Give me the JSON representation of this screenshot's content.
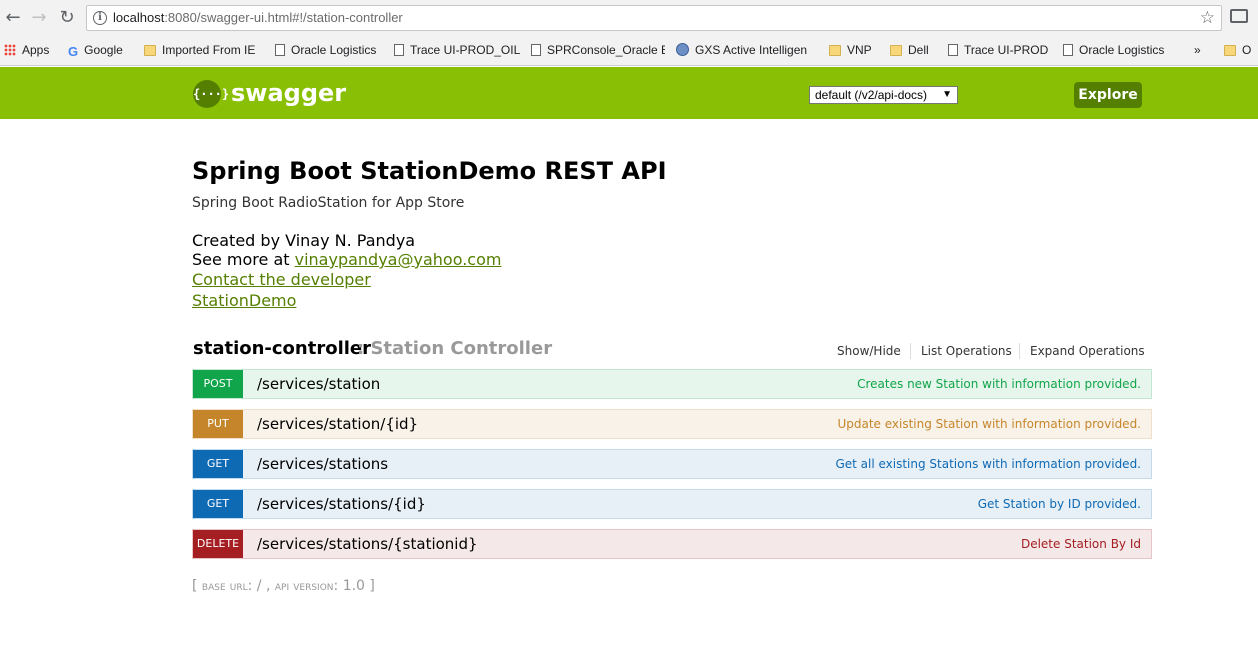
{
  "browser": {
    "url_host": "localhost",
    "url_rest": ":8080/swagger-ui.html#!/station-controller",
    "bookmarks": [
      {
        "label": "Apps",
        "icon": "apps-grid-icon"
      },
      {
        "label": "Google",
        "icon": "google-icon"
      },
      {
        "label": "Imported From IE",
        "icon": "folder-icon"
      },
      {
        "label": "Oracle Logistics",
        "icon": "page-icon"
      },
      {
        "label": "Trace UI-PROD_OIL",
        "icon": "page-icon"
      },
      {
        "label": "SPRConsole_Oracle E",
        "icon": "page-icon"
      },
      {
        "label": "GXS  Active Intelligen",
        "icon": "globe-icon"
      },
      {
        "label": "VNP",
        "icon": "folder-icon"
      },
      {
        "label": "Dell",
        "icon": "folder-icon"
      },
      {
        "label": "Trace UI-PROD",
        "icon": "page-icon"
      },
      {
        "label": "Oracle Logistics",
        "icon": "page-icon"
      },
      {
        "label": "»",
        "icon": ""
      },
      {
        "label": "O",
        "icon": "folder-icon"
      }
    ]
  },
  "header": {
    "logo_symbol": "{···}",
    "logo_text": "swagger",
    "spec_select": "default (/v2/api-docs)",
    "explore_label": "Explore"
  },
  "info": {
    "title": "Spring Boot StationDemo REST API",
    "description": "Spring Boot RadioStation for App Store",
    "created_by": "Created by Vinay N. Pandya",
    "see_more_prefix": "See more at ",
    "email": "vinaypandya@yahoo.com",
    "contact": "Contact the developer",
    "station_demo": "StationDemo"
  },
  "controller": {
    "name": "station-controller",
    "description": ": Station Controller",
    "show_hide": "Show/Hide",
    "list_ops": "List Operations",
    "expand_ops": "Expand Operations"
  },
  "operations": [
    {
      "method": "POST",
      "path": "/services/station",
      "summary": "Creates new Station with information provided.",
      "color": "#10a54a"
    },
    {
      "method": "PUT",
      "path": "/services/station/{id}",
      "summary": "Update existing Station with information provided.",
      "color": "#c5862b"
    },
    {
      "method": "GET",
      "path": "/services/stations",
      "summary": "Get all existing Stations with information provided.",
      "color": "#0f6ab4"
    },
    {
      "method": "GET",
      "path": "/services/stations/{id}",
      "summary": "Get Station by ID provided.",
      "color": "#0f6ab4"
    },
    {
      "method": "DELETE",
      "path": "/services/stations/{stationid}",
      "summary": "Delete Station By Id",
      "color": "#a41e22"
    }
  ],
  "footer": {
    "open": "[ ",
    "base_url_label": "base url",
    "base_url_value": ": / , ",
    "api_version_label": "api version",
    "api_version_value": ": 1.0 ]"
  },
  "colors": {
    "swagger_green": "#89bf04",
    "dark_green": "#547f00"
  }
}
